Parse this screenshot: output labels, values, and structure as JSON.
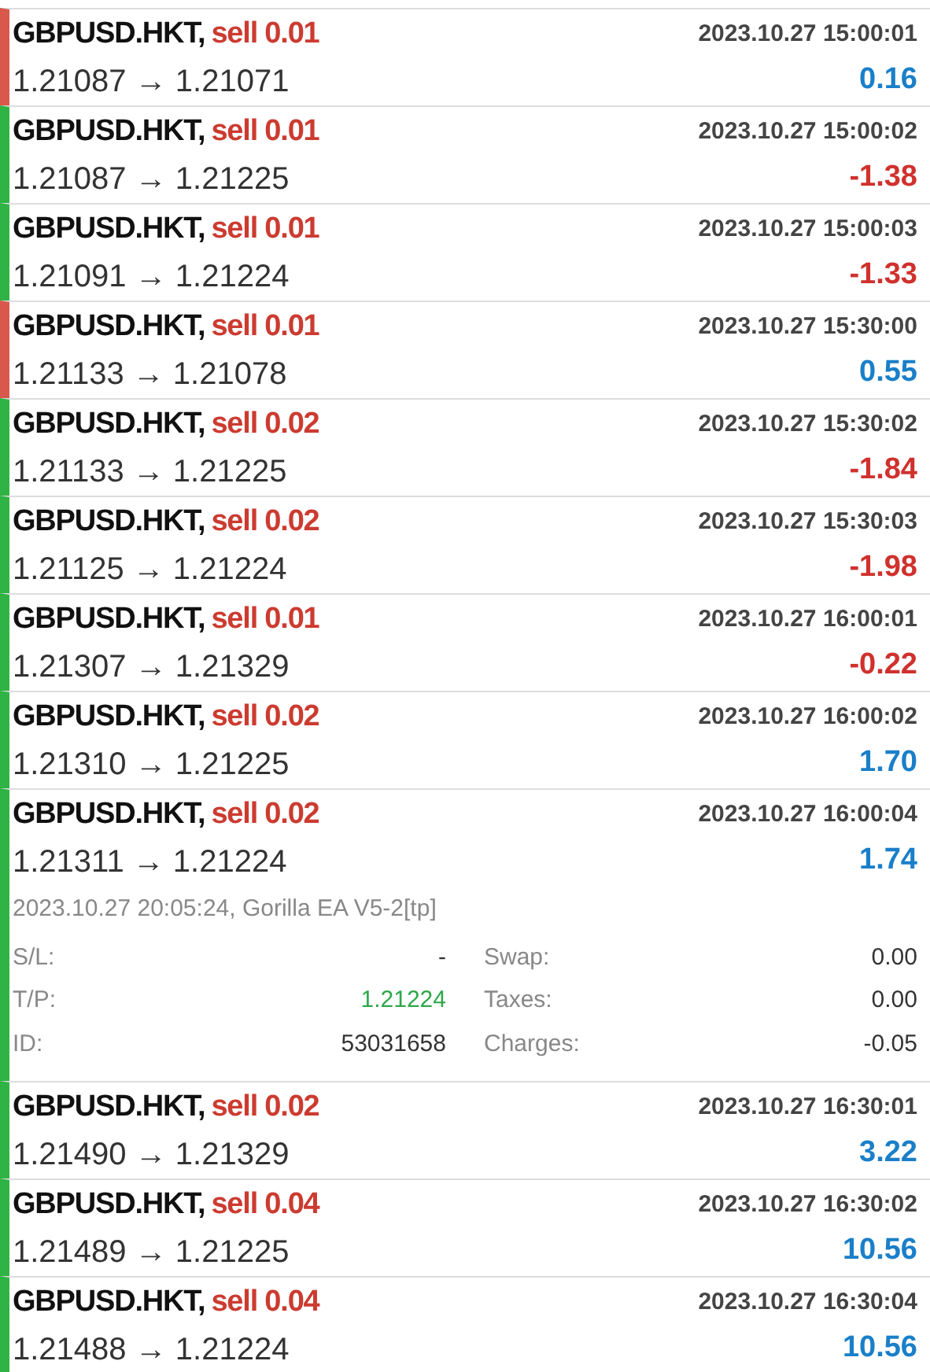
{
  "deals": [
    {
      "symbol": "GBPUSD.HKT,",
      "action": "sell 0.01",
      "time": "2023.10.27 15:00:01",
      "prices": "1.21087 → 1.21071",
      "profit": "0.16",
      "loss": false,
      "color": "#d9584c"
    },
    {
      "symbol": "GBPUSD.HKT,",
      "action": "sell 0.01",
      "time": "2023.10.27 15:00:02",
      "prices": "1.21087 → 1.21225",
      "profit": "-1.38",
      "loss": true,
      "color": "#2fb344"
    },
    {
      "symbol": "GBPUSD.HKT,",
      "action": "sell 0.01",
      "time": "2023.10.27 15:00:03",
      "prices": "1.21091 → 1.21224",
      "profit": "-1.33",
      "loss": true,
      "color": "#2fb344"
    },
    {
      "symbol": "GBPUSD.HKT,",
      "action": "sell 0.01",
      "time": "2023.10.27 15:30:00",
      "prices": "1.21133 → 1.21078",
      "profit": "0.55",
      "loss": false,
      "color": "#d9584c"
    },
    {
      "symbol": "GBPUSD.HKT,",
      "action": "sell 0.02",
      "time": "2023.10.27 15:30:02",
      "prices": "1.21133 → 1.21225",
      "profit": "-1.84",
      "loss": true,
      "color": "#2fb344"
    },
    {
      "symbol": "GBPUSD.HKT,",
      "action": "sell 0.02",
      "time": "2023.10.27 15:30:03",
      "prices": "1.21125 → 1.21224",
      "profit": "-1.98",
      "loss": true,
      "color": "#2fb344"
    },
    {
      "symbol": "GBPUSD.HKT,",
      "action": "sell 0.01",
      "time": "2023.10.27 16:00:01",
      "prices": "1.21307 → 1.21329",
      "profit": "-0.22",
      "loss": true,
      "color": "#2fb344"
    },
    {
      "symbol": "GBPUSD.HKT,",
      "action": "sell 0.02",
      "time": "2023.10.27 16:00:02",
      "prices": "1.21310 → 1.21225",
      "profit": "1.70",
      "loss": false,
      "color": "#2fb344"
    },
    {
      "symbol": "GBPUSD.HKT,",
      "action": "sell 0.02",
      "time": "2023.10.27 16:00:04",
      "prices": "1.21311 → 1.21224",
      "profit": "1.74",
      "loss": false,
      "color": "#2fb344",
      "details": {
        "comment": "2023.10.27 20:05:24, Gorilla EA V5-2[tp]",
        "fields": [
          {
            "label": "S/L:",
            "value": "-",
            "kind": "plain"
          },
          {
            "label": "Swap:",
            "value": "0.00",
            "kind": "plain"
          },
          {
            "label": "T/P:",
            "value": "1.21224",
            "kind": "tp"
          },
          {
            "label": "Taxes:",
            "value": "0.00",
            "kind": "plain"
          },
          {
            "label": "ID:",
            "value": "53031658",
            "kind": "plain"
          },
          {
            "label": "Charges:",
            "value": "-0.05",
            "kind": "plain"
          }
        ]
      }
    },
    {
      "symbol": "GBPUSD.HKT,",
      "action": "sell 0.02",
      "time": "2023.10.27 16:30:01",
      "prices": "1.21490 → 1.21329",
      "profit": "3.22",
      "loss": false,
      "color": "#2fb344"
    },
    {
      "symbol": "GBPUSD.HKT,",
      "action": "sell 0.04",
      "time": "2023.10.27 16:30:02",
      "prices": "1.21489 → 1.21225",
      "profit": "10.56",
      "loss": false,
      "color": "#2fb344"
    },
    {
      "symbol": "GBPUSD.HKT,",
      "action": "sell 0.04",
      "time": "2023.10.27 16:30:04",
      "prices": "1.21488 → 1.21224",
      "profit": "10.56",
      "loss": false,
      "color": "#2fb344"
    }
  ]
}
